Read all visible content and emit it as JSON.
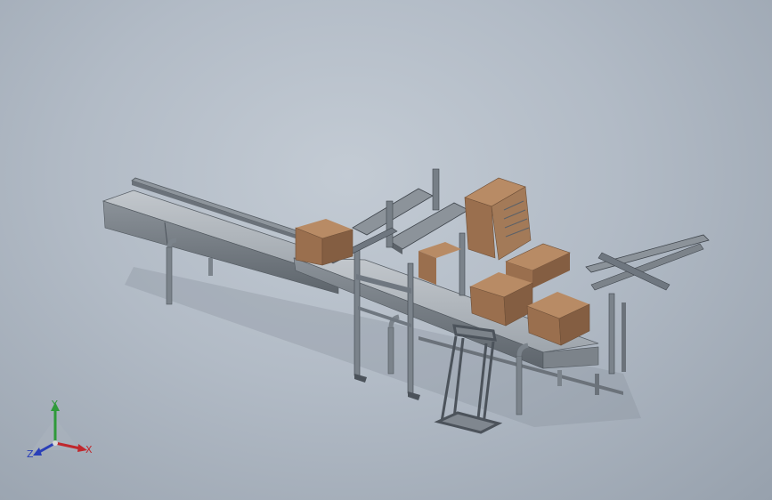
{
  "viewport": {
    "background_top": "#c3cbd4",
    "background_bottom": "#97a1ad"
  },
  "colors": {
    "carton": "#a07452",
    "carton_light": "#b88b65",
    "carton_dark": "#7e5a3e",
    "frame": "#6f7882",
    "frame_dark": "#4c535b",
    "conveyor": "#9aa1a8",
    "conveyor_top": "#b7bdc3"
  },
  "triad": {
    "x_label": "X",
    "y_label": "Y",
    "z_label": "Z",
    "x_color": "#c0282d",
    "y_color": "#2f9a3a",
    "z_color": "#2a3fb8"
  }
}
